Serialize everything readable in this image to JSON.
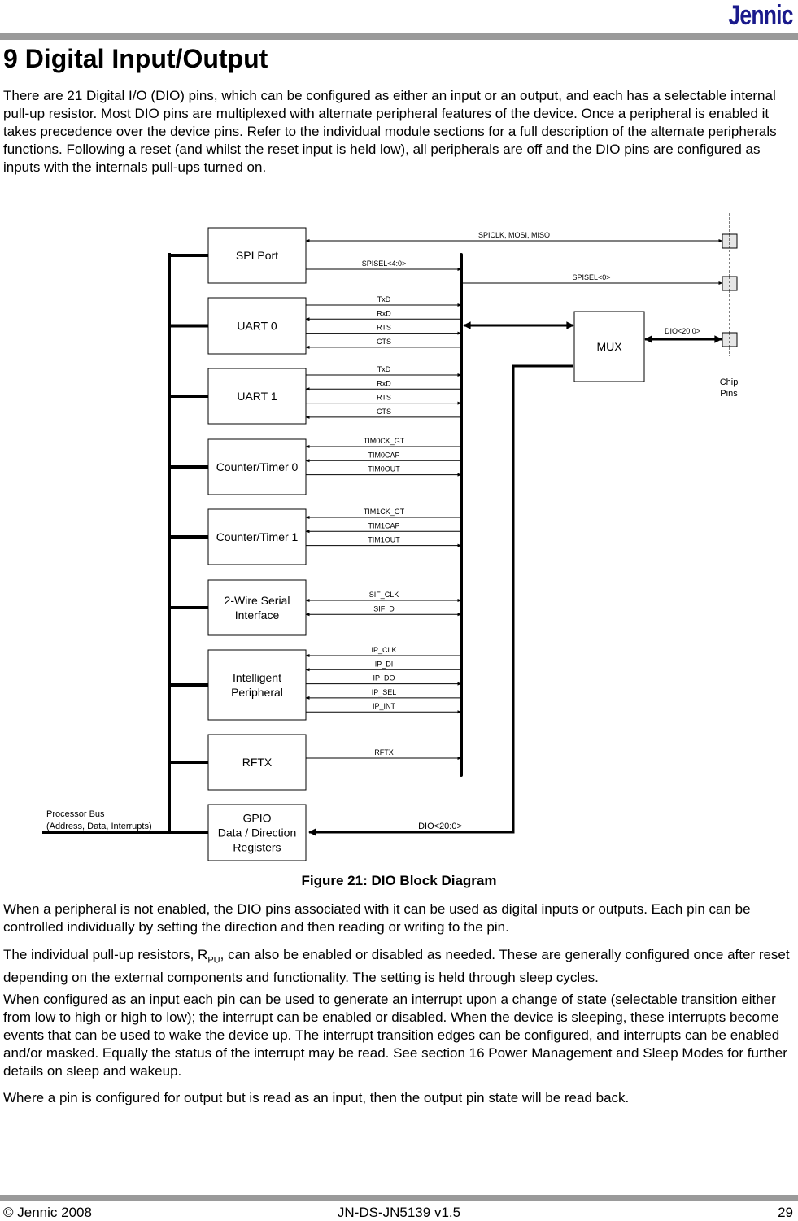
{
  "header": {
    "logo": "Jennic"
  },
  "section": {
    "title": "9 Digital Input/Output"
  },
  "paragraphs": {
    "intro": "There are 21 Digital I/O (DIO) pins, which can be configured as either an input or an output, and each has a selectable internal pull-up resistor.  Most DIO pins are multiplexed with alternate peripheral features of the device. Once a peripheral is enabled it takes precedence over the device pins.  Refer to the individual module sections for a full description of the alternate peripherals functions.  Following a reset (and whilst the reset input is held low), all peripherals are off and the DIO pins are configured as inputs with the internals pull-ups turned on.",
    "not_enabled": "When a peripheral is not enabled, the DIO pins associated with it can be used as digital inputs or outputs.  Each pin can be controlled individually by setting the direction and then reading or writing to the pin.",
    "pullup_pre": "The individual pull-up resistors, R",
    "pullup_sub": "PU",
    "pullup_post": ", can also be enabled or disabled as needed. These are generally configured once after reset depending on the external components and functionality. The setting is held through sleep cycles.",
    "interrupts": "When configured as an input each pin can be used to generate an interrupt upon a change of state (selectable transition either from low to high or high to low); the interrupt can be enabled or disabled.  When the device is sleeping, these interrupts become events that can be used to wake the device up.  The interrupt transition edges can be configured, and interrupts can be enabled and/or masked. Equally the status of the interrupt may be read.  See section 16 Power Management and Sleep Modes for further details on sleep and wakeup.",
    "readback": "Where a pin is configured for output but is read as an input, then the output pin state will be read back."
  },
  "figure": {
    "caption": "Figure 21: DIO Block Diagram",
    "blocks": [
      {
        "lines": [
          "SPI Port"
        ],
        "signals": []
      },
      {
        "lines": [
          "UART 0"
        ],
        "signals": [
          {
            "label": "TxD",
            "dir": "out"
          },
          {
            "label": "RxD",
            "dir": "in"
          },
          {
            "label": "RTS",
            "dir": "out"
          },
          {
            "label": "CTS",
            "dir": "in"
          }
        ]
      },
      {
        "lines": [
          "UART 1"
        ],
        "signals": [
          {
            "label": "TxD",
            "dir": "out"
          },
          {
            "label": "RxD",
            "dir": "in"
          },
          {
            "label": "RTS",
            "dir": "out"
          },
          {
            "label": "CTS",
            "dir": "in"
          }
        ]
      },
      {
        "lines": [
          "Counter/Timer 0"
        ],
        "signals": [
          {
            "label": "TIM0CK_GT",
            "dir": "in"
          },
          {
            "label": "TIM0CAP",
            "dir": "in"
          },
          {
            "label": "TIM0OUT",
            "dir": "out"
          }
        ]
      },
      {
        "lines": [
          "Counter/Timer 1"
        ],
        "signals": [
          {
            "label": "TIM1CK_GT",
            "dir": "in"
          },
          {
            "label": "TIM1CAP",
            "dir": "in"
          },
          {
            "label": "TIM1OUT",
            "dir": "out"
          }
        ]
      },
      {
        "lines": [
          "2-Wire Serial",
          "Interface"
        ],
        "signals": [
          {
            "label": "SIF_CLK",
            "dir": "both"
          },
          {
            "label": "SIF_D",
            "dir": "both"
          }
        ]
      },
      {
        "lines": [
          "Intelligent",
          "Peripheral"
        ],
        "signals": [
          {
            "label": "IP_CLK",
            "dir": "in"
          },
          {
            "label": "IP_DI",
            "dir": "in"
          },
          {
            "label": "IP_DO",
            "dir": "out"
          },
          {
            "label": "IP_SEL",
            "dir": "in"
          },
          {
            "label": "IP_INT",
            "dir": "out"
          }
        ]
      },
      {
        "lines": [
          "RFTX"
        ],
        "signals": [
          {
            "label": "RFTX",
            "dir": "out"
          }
        ]
      },
      {
        "lines": [
          "GPIO",
          "Data / Direction",
          "Registers"
        ],
        "signals": []
      }
    ],
    "spi_bus_label": "SPICLK, MOSI, MISO",
    "spisel_label": "SPISEL<4:0>",
    "spisel0_label": "SPISEL<0>",
    "mux_label": "MUX",
    "mux_dio_label": "DIO<20:0>",
    "gpio_dio_label": "DIO<20:0>",
    "chip_pins_label": [
      "Chip",
      "Pins"
    ],
    "processor_bus_label": [
      "Processor Bus",
      "(Address, Data, Interrupts)"
    ]
  },
  "footer": {
    "copyright": "© Jennic 2008",
    "doc_id": "JN-DS-JN5139 v1.5",
    "page": "29"
  }
}
